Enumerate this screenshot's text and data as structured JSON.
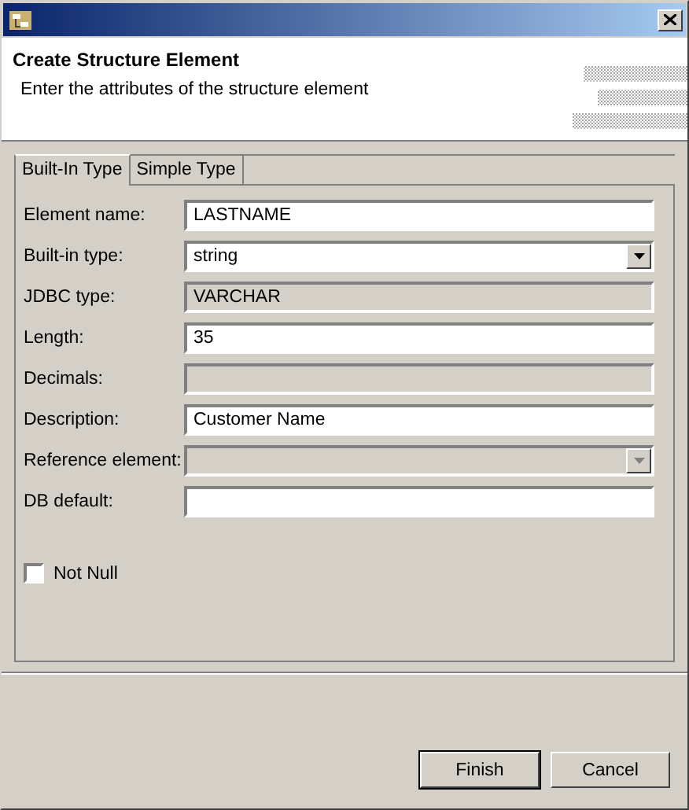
{
  "header": {
    "title": "Create Structure Element",
    "message": "Enter the attributes of the structure element"
  },
  "tabs": [
    {
      "label": "Built-In Type",
      "selected": true
    },
    {
      "label": "Simple Type",
      "selected": false
    }
  ],
  "fields": [
    {
      "label": "Element name:",
      "kind": "text",
      "value": "LASTNAME",
      "disabled": false
    },
    {
      "label": "Built-in type:",
      "kind": "combo",
      "value": "string",
      "disabled": false
    },
    {
      "label": "JDBC type:",
      "kind": "text",
      "value": "VARCHAR",
      "disabled": true
    },
    {
      "label": "Length:",
      "kind": "text",
      "value": "35",
      "disabled": false
    },
    {
      "label": "Decimals:",
      "kind": "text",
      "disabled": true
    },
    {
      "label": "Description:",
      "kind": "text",
      "value": "Customer Name",
      "disabled": false
    },
    {
      "label": "Reference element:",
      "kind": "combo",
      "disabled": true
    },
    {
      "label": "DB default:",
      "kind": "text",
      "disabled": false
    }
  ],
  "not_null": {
    "label": "Not Null",
    "checked": false
  },
  "buttons": [
    {
      "label": "Finish",
      "default": true
    },
    {
      "label": "Cancel",
      "default": false
    }
  ]
}
